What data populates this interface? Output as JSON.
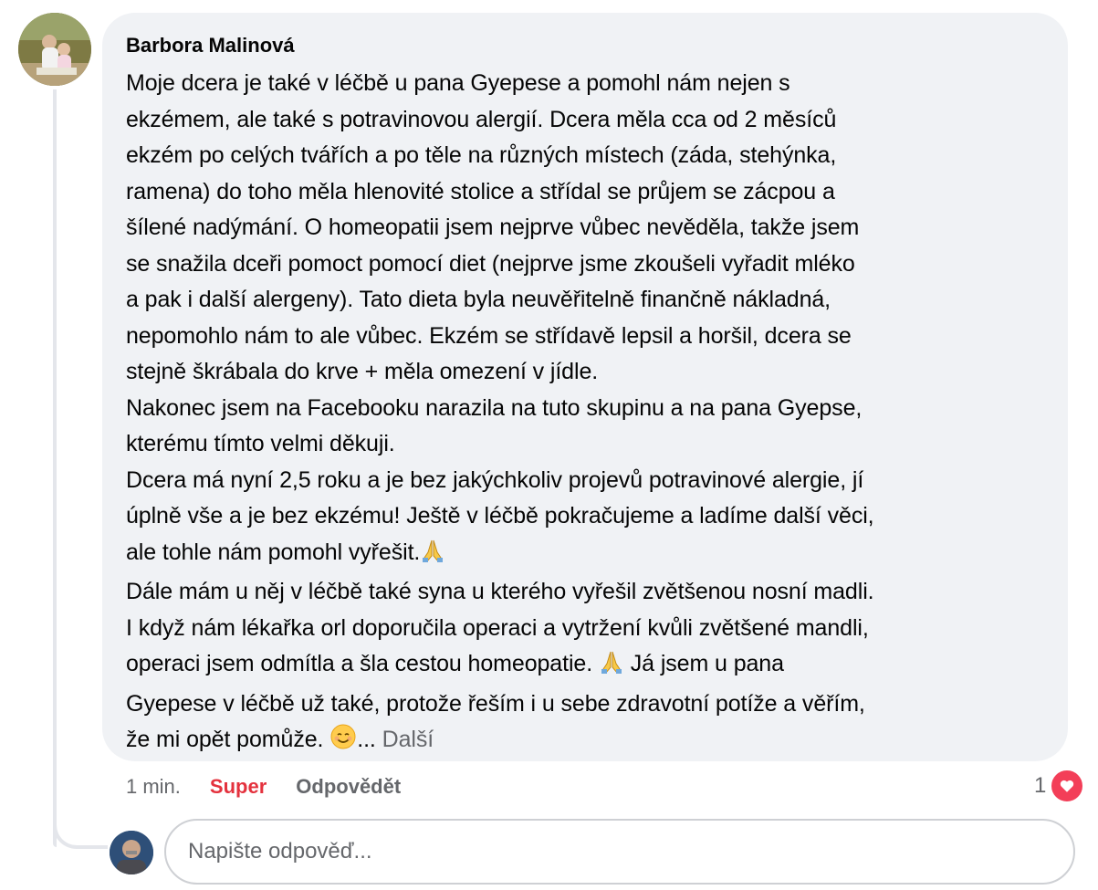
{
  "comment": {
    "author": "Barbora Malinová",
    "lines": [
      "Moje dcera je také v léčbě u pana Gyepese a pomohl nám nejen s",
      "ekzémem, ale také s potravinovou alergií. Dcera měla cca od 2 měsíců",
      "ekzém po celých tvářích a po těle na různých místech (záda, stehýnka,",
      "ramena) do toho měla hlenovité stolice a střídal se průjem se zácpou a",
      "šílené nadýmání. O homeopatii jsem nejprve vůbec nevěděla, takže jsem",
      "se snažila dceři pomoct pomocí diet (nejprve jsme zkoušeli vyřadit mléko",
      "a pak i další alergeny). Tato dieta byla neuvěřitelně finančně nákladná,",
      "nepomohlo nám to ale vůbec. Ekzém se střídavě lepsil a horšil, dcera se",
      "stejně škrábala do krve + měla omezení v jídle.",
      "Nakonec jsem na Facebooku narazila na tuto skupinu a na pana Gyepse,",
      "kterému tímto velmi děkuji.",
      "Dcera má nyní 2,5 roku a je bez jakýchkoliv projevů potravinové alergie, jí",
      "úplně vše a je bez ekzému! Ještě v léčbě pokračujeme a ladíme další věci,",
      "ale tohle nám pomohl vyřešit.",
      "Dále mám u něj v léčbě také syna u kterého vyřešil zvětšenou nosní madli.",
      "I když nám lékařka orl doporučila operaci a vytržení kvůli zvětšené mandli,",
      "operaci jsem odmítla a šla cestou homeopatie.",
      " Já jsem u pana",
      "Gyepese v léčbě už také, protože řeším i u sebe zdravotní potíže a věřím,",
      "že mi opět pomůže. ",
      "... ",
      "Další"
    ],
    "emoji_pray": "praying-hands",
    "emoji_smile": "smiling-face"
  },
  "actions": {
    "time": "1 min.",
    "like_label": "Super",
    "reply_label": "Odpovědět"
  },
  "reactions": {
    "count": "1",
    "type": "love",
    "color": "#f33e58"
  },
  "reply_input": {
    "placeholder": "Napište odpověď..."
  }
}
